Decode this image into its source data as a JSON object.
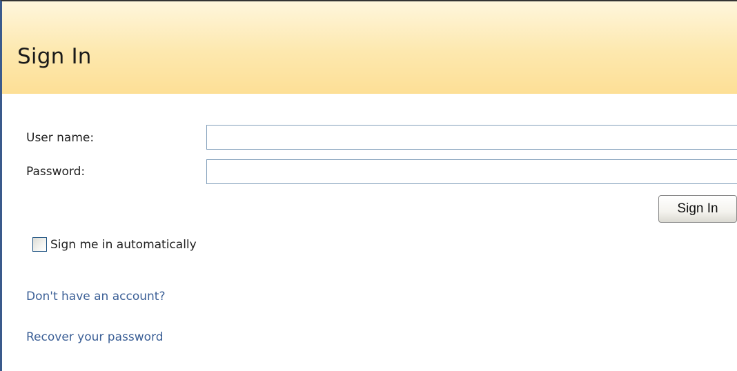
{
  "header": {
    "title": "Sign In"
  },
  "form": {
    "username_label": "User name:",
    "username_value": "",
    "password_label": "Password:",
    "password_value": "",
    "submit_label": "Sign In",
    "remember_label": "Sign me in automatically",
    "remember_checked": false
  },
  "links": {
    "no_account": "Don't have an account?",
    "recover_password": "Recover your password"
  },
  "colors": {
    "header_gradient_top": "#fef6dc",
    "header_gradient_bottom": "#fddf96",
    "link": "#3b5f96",
    "field_border": "#7f9db9"
  }
}
